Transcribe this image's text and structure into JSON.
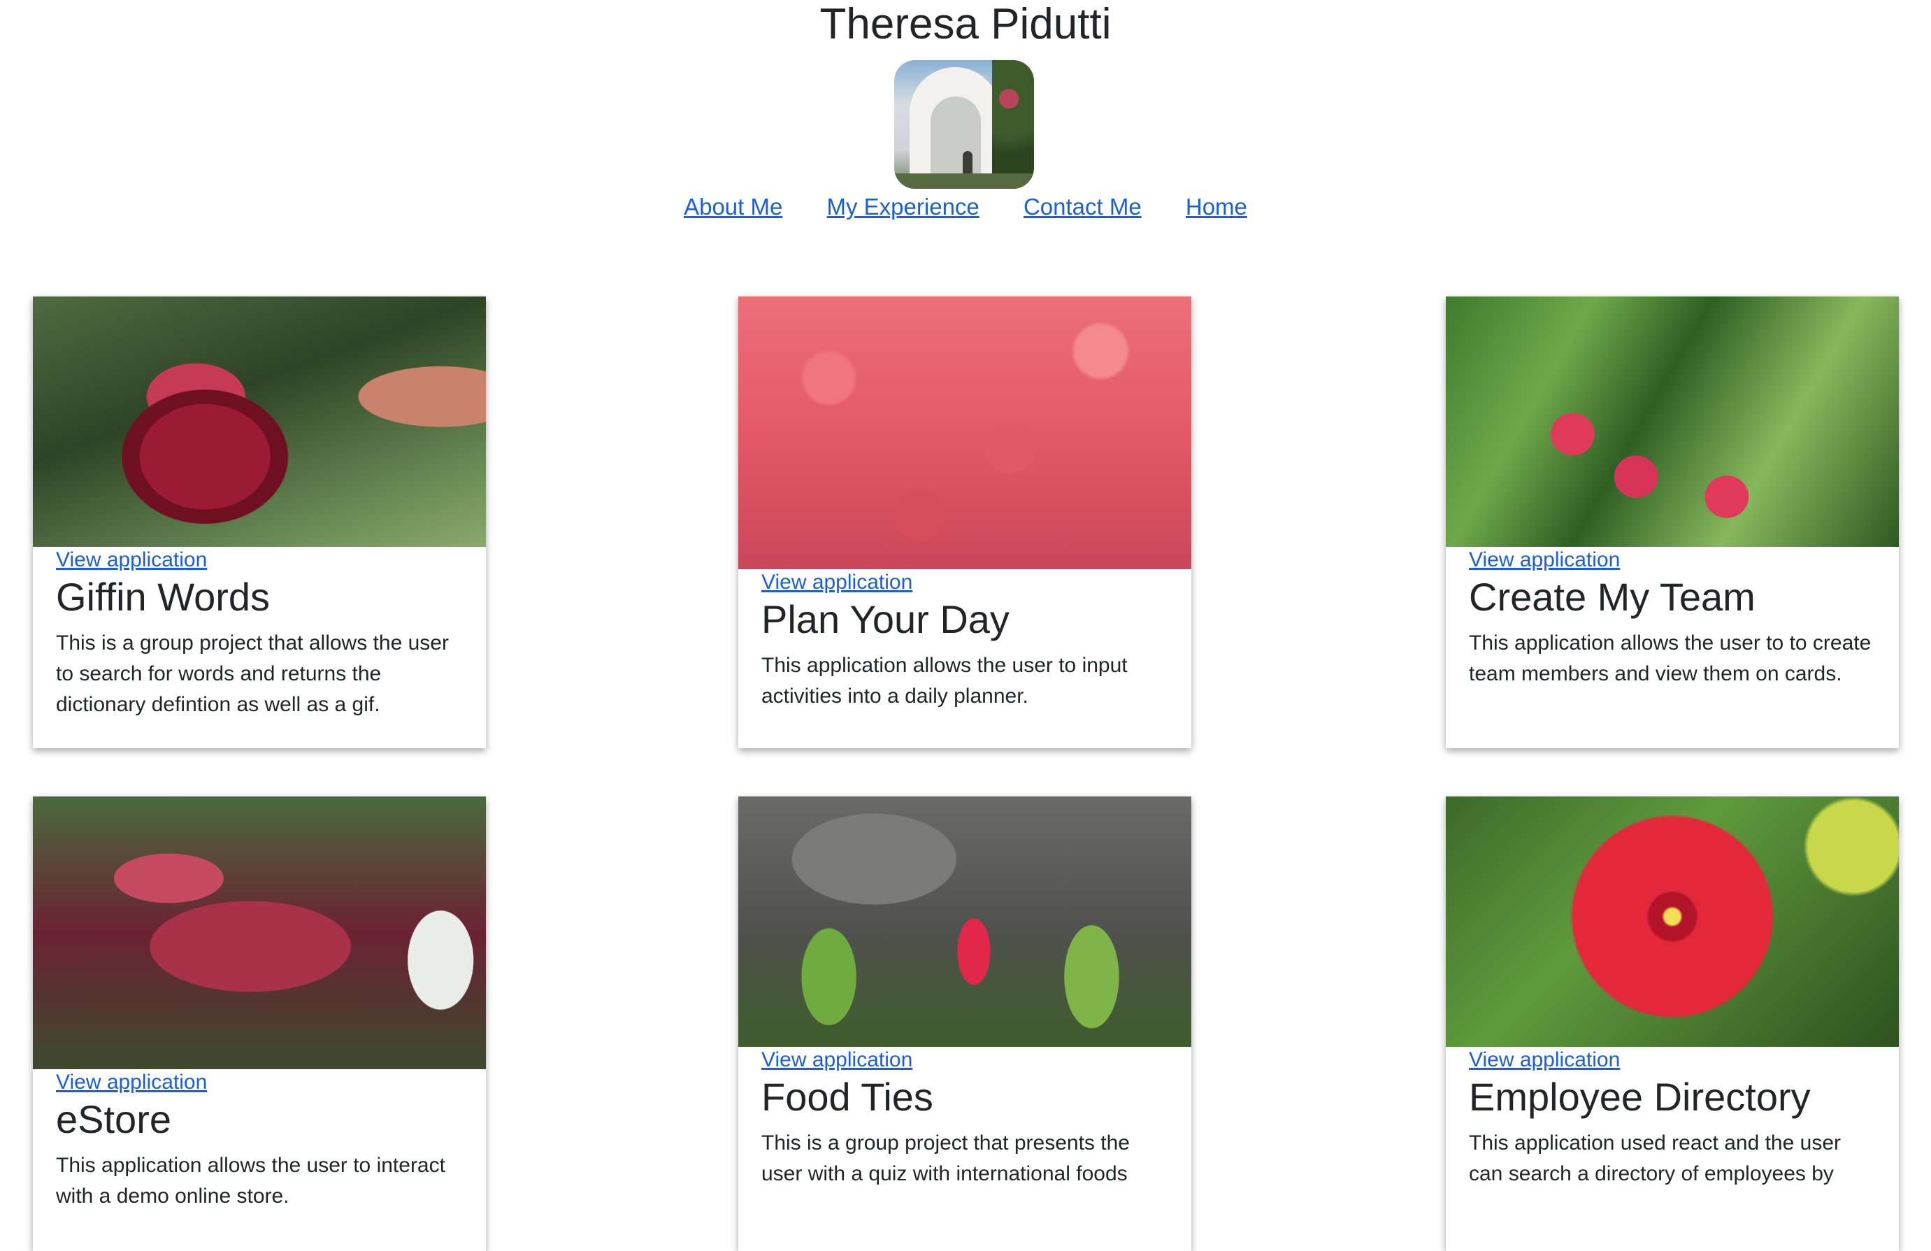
{
  "header": {
    "title": "Theresa Pidutti",
    "avatar_alt": "profile photo"
  },
  "nav": {
    "items": [
      {
        "label": "About Me"
      },
      {
        "label": "My Experience"
      },
      {
        "label": "Contact Me"
      },
      {
        "label": "Home"
      }
    ]
  },
  "projects": [
    {
      "link_label": "View application",
      "title": "Giffin Words",
      "description": "This is a group project that allows the user to search for words and returns the dictionary defintion as well as a gif."
    },
    {
      "link_label": "View application",
      "title": "Plan Your Day",
      "description": "This application allows the user to input activities into a daily planner."
    },
    {
      "link_label": "View application",
      "title": "Create My Team",
      "description": "This application allows the user to to create team members and view them on cards."
    },
    {
      "link_label": "View application",
      "title": "eStore",
      "description": "This application allows the user to interact with a demo online store."
    },
    {
      "link_label": "View application",
      "title": "Food Ties",
      "description": "This is a group project that presents the user with a quiz with international foods"
    },
    {
      "link_label": "View application",
      "title": "Employee Directory",
      "description": "This application used react and the user can search a directory of employees by"
    }
  ]
}
